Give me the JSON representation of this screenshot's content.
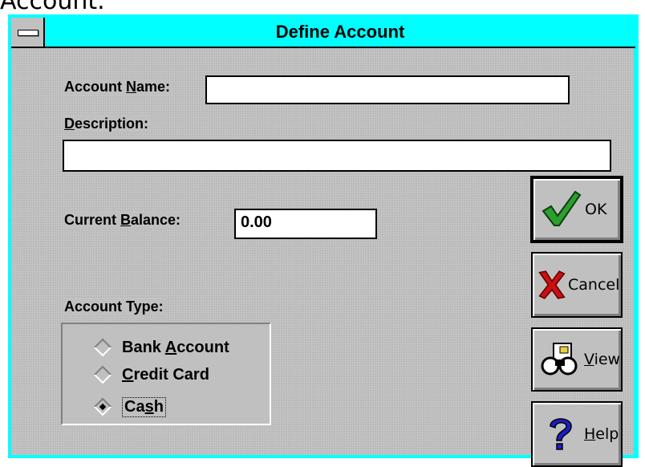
{
  "top_caption": "Account.",
  "window": {
    "title": "Define Account",
    "system_menu": "—"
  },
  "form": {
    "account_name": {
      "label_pre": "Account ",
      "label_accel": "N",
      "label_post": "ame:",
      "value": ""
    },
    "description": {
      "label_pre": "",
      "label_accel": "D",
      "label_post": "escription:",
      "value": ""
    },
    "current_balance": {
      "label_pre": "Current ",
      "label_accel": "B",
      "label_post": "alance:",
      "value": "0.00"
    },
    "account_type": {
      "label": "Account Type:",
      "options": [
        {
          "pre": "Bank ",
          "accel": "A",
          "post": "ccount",
          "checked": false
        },
        {
          "pre": "",
          "accel": "C",
          "post": "redit Card",
          "checked": false
        },
        {
          "pre": "Ca",
          "accel": "s",
          "post": "h",
          "checked": true
        }
      ]
    }
  },
  "buttons": {
    "ok": {
      "pre": "",
      "accel": "",
      "post": "OK",
      "icon": "checkmark-icon"
    },
    "cancel": {
      "pre": "",
      "accel": "",
      "post": "Cancel",
      "icon": "x-mark-icon"
    },
    "view": {
      "pre": "",
      "accel": "V",
      "post": "iew",
      "icon": "binoculars-icon"
    },
    "help": {
      "pre": "",
      "accel": "H",
      "post": "elp",
      "icon": "question-mark-icon"
    }
  },
  "colors": {
    "titlebar": "#00ffff",
    "face": "#c0c0c0",
    "ok_check": "#2e9e2e",
    "cancel_x": "#cc1010",
    "help_q": "#1e1ec8"
  }
}
